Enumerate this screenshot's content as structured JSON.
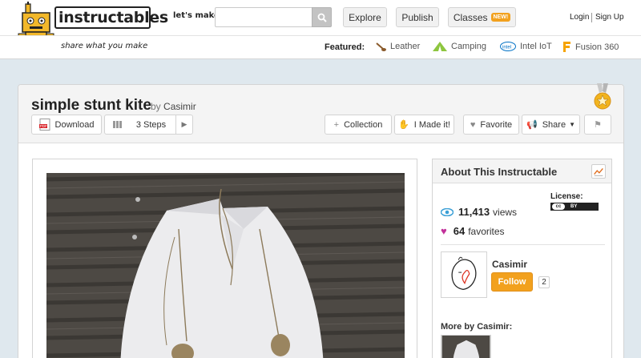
{
  "header": {
    "logo_text": "instructables",
    "tagline": "share what you make",
    "search_label": "let's make",
    "search_placeholder": "",
    "nav": {
      "explore": "Explore",
      "publish": "Publish",
      "classes": "Classes",
      "new_badge": "NEW!"
    },
    "auth": {
      "login": "Login",
      "signup": "Sign Up"
    }
  },
  "featured": {
    "label": "Featured:",
    "items": [
      "Leather",
      "Camping",
      "Intel IoT",
      "Fusion 360"
    ]
  },
  "project": {
    "title": "simple stunt kite",
    "by": "by",
    "author": "Casimir",
    "toolbar": {
      "download": "Download",
      "steps": "3 Steps",
      "collection": "Collection",
      "made_it": "I Made it!",
      "favorite": "Favorite",
      "share": "Share"
    }
  },
  "about": {
    "title": "About This Instructable",
    "views_value": "11,413",
    "views_label": "views",
    "favorites_value": "64",
    "favorites_label": "favorites",
    "license_label": "License:",
    "license_badge": "BY",
    "author": "Casimir",
    "follow": "Follow",
    "follow_count": "2",
    "more_by": "More by Casimir:"
  },
  "colors": {
    "accent": "#f2a11e",
    "page_bg": "#dfe8ee",
    "views_icon": "#3a9fd6",
    "favorites_icon": "#c2309a"
  }
}
